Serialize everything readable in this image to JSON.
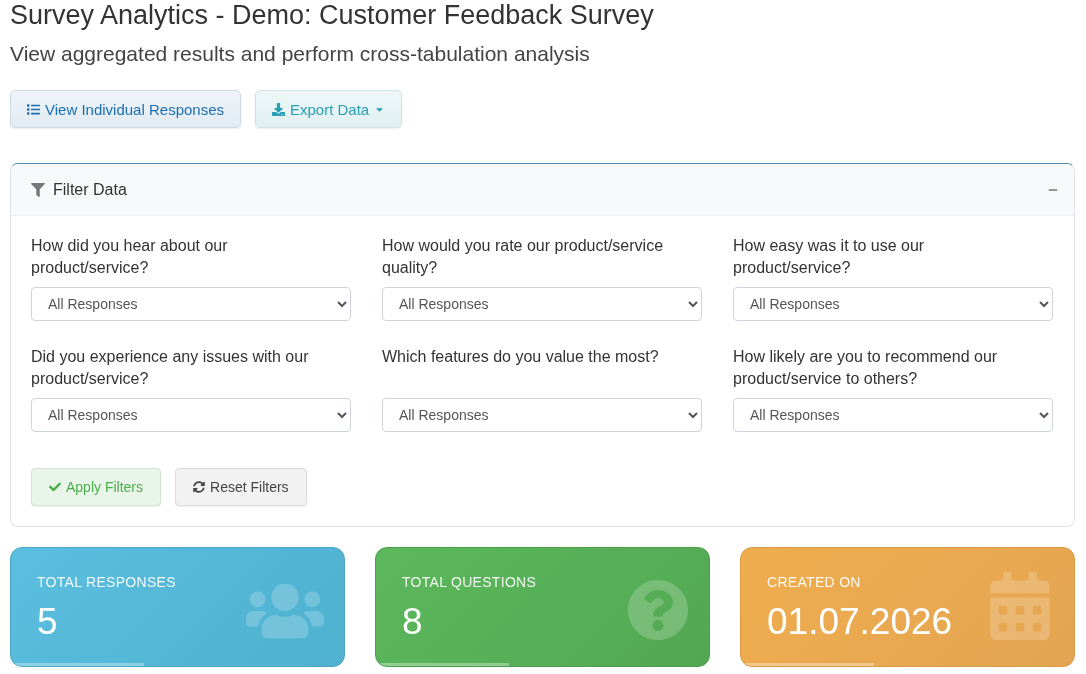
{
  "header": {
    "title": "Survey Analytics - Demo: Customer Feedback Survey",
    "subtitle": "View aggregated results and perform cross-tabulation analysis"
  },
  "actions": [
    {
      "label": "View Individual Responses",
      "kind": "list"
    },
    {
      "label": "Export Data",
      "kind": "export"
    }
  ],
  "filter_panel": {
    "title": "Filter Data",
    "expanded": true,
    "filters": [
      {
        "question": "How did you hear about our product/service?",
        "value": "All Responses"
      },
      {
        "question": "How would you rate our product/service quality?",
        "value": "All Responses"
      },
      {
        "question": "How easy was it to use our product/service?",
        "value": "All Responses"
      },
      {
        "question": "Did you experience any issues with our product/service?",
        "value": "All Responses"
      },
      {
        "question": "Which features do you value the most?",
        "value": "All Responses"
      },
      {
        "question": "How likely are you to recommend our product/service to others?",
        "value": "All Responses"
      }
    ],
    "buttons": [
      {
        "label": "Apply Filters",
        "kind": "apply"
      },
      {
        "label": "Reset Filters",
        "kind": "reset"
      }
    ]
  },
  "stats": [
    {
      "label": "TOTAL RESPONSES",
      "value": "5",
      "kind": "responses"
    },
    {
      "label": "TOTAL QUESTIONS",
      "value": "8",
      "kind": "questions"
    },
    {
      "label": "CREATED ON",
      "value": "01.07.2026",
      "kind": "created"
    }
  ]
}
